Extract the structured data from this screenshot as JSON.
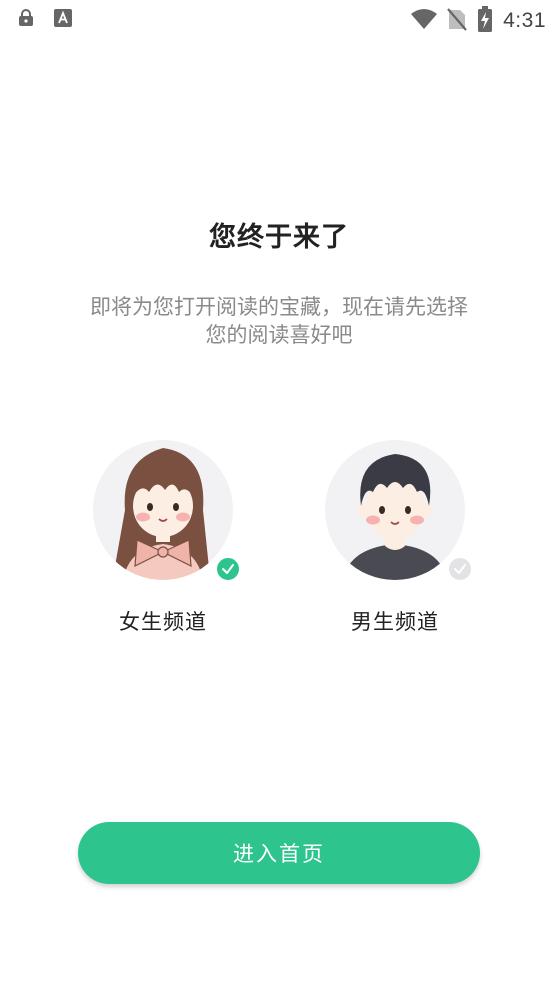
{
  "status_bar": {
    "time": "4:31",
    "left_icons": [
      "lock-icon",
      "keyboard-a-icon"
    ],
    "right_icons": [
      "wifi-icon",
      "no-sim-icon",
      "battery-charging-icon"
    ]
  },
  "header": {
    "title": "您终于来了"
  },
  "subtitle": "即将为您打开阅读的宝藏，现在请先选择您的阅读喜好吧",
  "channels": [
    {
      "label": "女生频道",
      "selected": true
    },
    {
      "label": "男生频道",
      "selected": false
    }
  ],
  "enter_button": {
    "label": "进入首页"
  },
  "colors": {
    "accent": "#2ec48e",
    "badge_off": "#e3e3e6",
    "avatar_bg": "#f2f2f5"
  }
}
